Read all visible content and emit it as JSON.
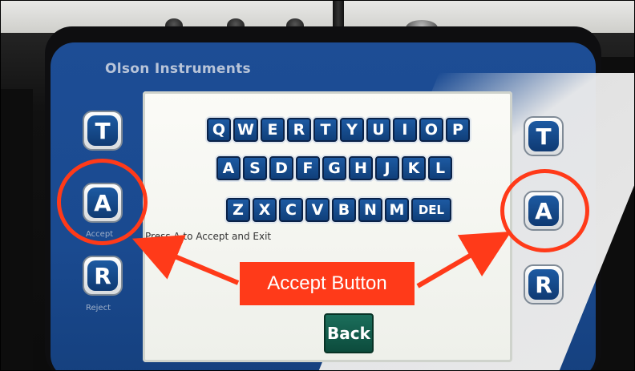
{
  "device": {
    "brand": "Olson Instruments"
  },
  "keyboard": {
    "rows": [
      [
        "Q",
        "W",
        "E",
        "R",
        "T",
        "Y",
        "U",
        "I",
        "O",
        "P"
      ],
      [
        "A",
        "S",
        "D",
        "F",
        "G",
        "H",
        "J",
        "K",
        "L"
      ],
      [
        "Z",
        "X",
        "C",
        "V",
        "B",
        "N",
        "M",
        "DEL"
      ]
    ]
  },
  "screen": {
    "hint": "Press A to Accept and Exit",
    "back_label": "Back"
  },
  "left_buttons": [
    {
      "key": "T",
      "label": ""
    },
    {
      "key": "A",
      "label": "Accept"
    },
    {
      "key": "R",
      "label": "Reject"
    }
  ],
  "right_buttons": [
    {
      "key": "T"
    },
    {
      "key": "A"
    },
    {
      "key": "R"
    }
  ],
  "annotation": {
    "callout": "Accept Button",
    "color": "#ff3a19"
  }
}
